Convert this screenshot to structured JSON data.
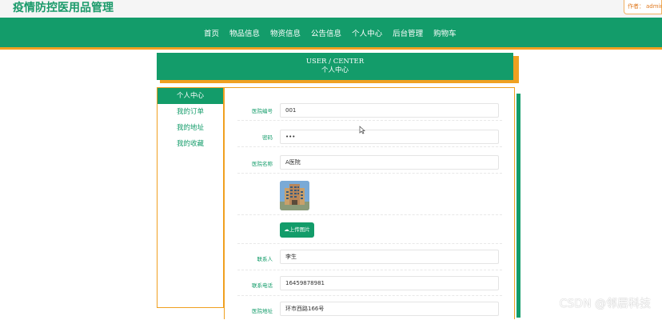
{
  "site": {
    "title": "疫情防控医用品管理"
  },
  "author": {
    "label": "作者：",
    "value": "admin"
  },
  "nav": {
    "items": [
      "首页",
      "物品信息",
      "物资信息",
      "公告信息",
      "个人中心",
      "后台管理",
      "购物车"
    ]
  },
  "banner": {
    "en": "USER / CENTER",
    "cn": "个人中心"
  },
  "sidebar": {
    "items": [
      "个人中心",
      "我的订单",
      "我的地址",
      "我的收藏"
    ],
    "active": "个人中心"
  },
  "form": {
    "hospital_no": {
      "label": "医院编号",
      "value": "001"
    },
    "password": {
      "label": "密码",
      "value": "•••"
    },
    "hospital_name": {
      "label": "医院名称",
      "value": "A医院"
    },
    "upload_label": "上传图片",
    "contact": {
      "label": "联系人",
      "value": "李生"
    },
    "phone": {
      "label": "联系电话",
      "value": "16459878981"
    },
    "address": {
      "label": "医院地址",
      "value": "环市西路166号"
    }
  },
  "watermark": "CSDN @邻居科技",
  "colors": {
    "primary": "#139c6a",
    "accent": "#f0a020"
  }
}
